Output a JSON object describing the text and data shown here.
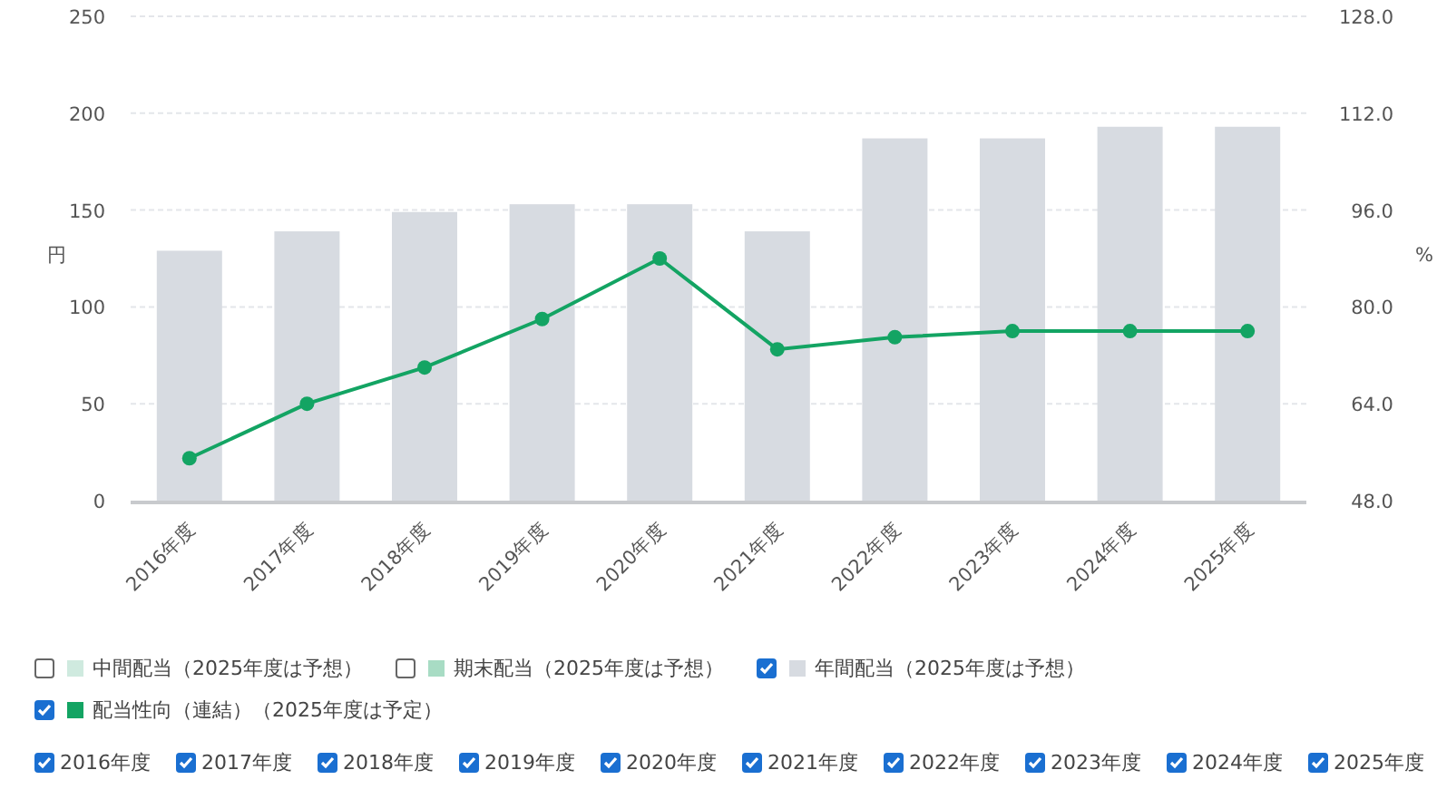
{
  "chart": {
    "chart_data": {
      "type": "bar",
      "grid": true,
      "ylabel": "円",
      "y2label": "%",
      "categories": [
        "2016年度",
        "2017年度",
        "2018年度",
        "2019年度",
        "2020年度",
        "2021年度",
        "2022年度",
        "2023年度",
        "2024年度",
        "2025年度"
      ],
      "ylim": [
        0,
        250
      ],
      "yticks": [
        0,
        50,
        100,
        150,
        200,
        250
      ],
      "y2lim": [
        48,
        128
      ],
      "y2ticks": [
        {
          "value": 48,
          "label": "48.0"
        },
        {
          "value": 64,
          "label": "64.0"
        },
        {
          "value": 80,
          "label": "80.0"
        },
        {
          "value": 96,
          "label": "96.0"
        },
        {
          "value": 112,
          "label": "112.0"
        },
        {
          "value": 128,
          "label": "128.0"
        }
      ],
      "series": [
        {
          "color": "#d7dbe1",
          "values": [
            129,
            139,
            149,
            153,
            153,
            139,
            187,
            187,
            193,
            193
          ]
        },
        {
          "color": "#13a463",
          "type": "line",
          "marker": "circle",
          "axis": "y2",
          "values": [
            55,
            64,
            70,
            78,
            88,
            73,
            75,
            76,
            76,
            76
          ]
        }
      ]
    }
  },
  "legend": [
    {
      "label": "中間配当（2025年度は予想）",
      "checked": false,
      "color": "#cfeadf"
    },
    {
      "label": "期末配当（2025年度は予想）",
      "checked": false,
      "color": "#a8dcc4"
    },
    {
      "label": "年間配当（2025年度は予想）",
      "checked": true,
      "color": "#d7dbe1"
    },
    {
      "label": "配当性向（連結）（2025年度は予定）",
      "checked": true,
      "color": "#13a463"
    }
  ],
  "years": [
    {
      "label": "2016年度",
      "checked": true
    },
    {
      "label": "2017年度",
      "checked": true
    },
    {
      "label": "2018年度",
      "checked": true
    },
    {
      "label": "2019年度",
      "checked": true
    },
    {
      "label": "2020年度",
      "checked": true
    },
    {
      "label": "2021年度",
      "checked": true
    },
    {
      "label": "2022年度",
      "checked": true
    },
    {
      "label": "2023年度",
      "checked": true
    },
    {
      "label": "2024年度",
      "checked": true
    },
    {
      "label": "2025年度",
      "checked": true
    }
  ]
}
